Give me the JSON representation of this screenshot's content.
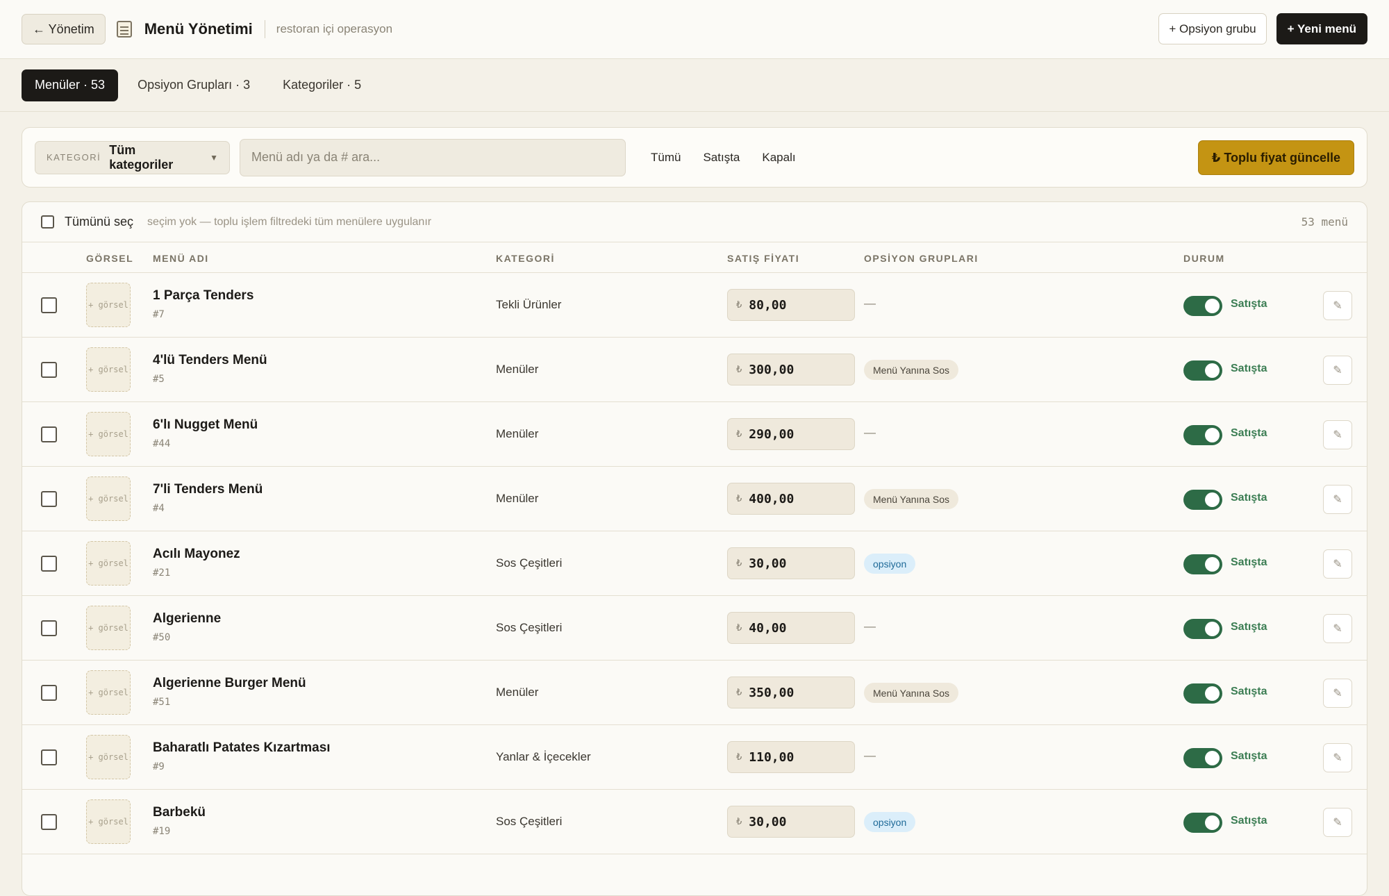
{
  "header": {
    "back_label": "← Yönetim",
    "title": "Menü Yönetimi",
    "subtitle": "restoran içi operasyon",
    "option_group_button": "+ Opsiyon grubu",
    "new_menu_button": "+ Yeni menü"
  },
  "tabs": [
    {
      "label": "Menüler · 53",
      "active": true
    },
    {
      "label": "Opsiyon Grupları · 3",
      "active": false
    },
    {
      "label": "Kategoriler · 5",
      "active": false
    }
  ],
  "filters": {
    "category_label": "KATEGORİ",
    "category_value": "Tüm kategoriler",
    "search_placeholder": "Menü adı ya da # ara...",
    "status_options": [
      "Tümü",
      "Satışta",
      "Kapalı"
    ],
    "bulk_price_button": "₺ Toplu fiyat güncelle"
  },
  "selection": {
    "select_all_label": "Tümünü seç",
    "hint": "seçim yok — toplu işlem filtredeki tüm menülere uygulanır",
    "count": "53 menü"
  },
  "columns": {
    "image": "GÖRSEL",
    "name": "MENÜ ADI",
    "category": "KATEGORİ",
    "price": "SATIŞ FİYATI",
    "option_groups": "OPSİYON GRUPLARI",
    "status": "DURUM"
  },
  "thumb_text": "+ görsel",
  "currency_symbol": "₺",
  "edit_icon": "pencil-icon",
  "rows": [
    {
      "name": "1 Parça Tenders",
      "id": "#7",
      "category": "Tekli Ürünler",
      "price": "80,00",
      "options": "—",
      "option_type": "none",
      "status": "Satışta"
    },
    {
      "name": "4'lü Tenders Menü",
      "id": "#5",
      "category": "Menüler",
      "price": "300,00",
      "options": "Menü Yanına Sos",
      "option_type": "sos",
      "status": "Satışta"
    },
    {
      "name": "6'lı Nugget Menü",
      "id": "#44",
      "category": "Menüler",
      "price": "290,00",
      "options": "—",
      "option_type": "none",
      "status": "Satışta"
    },
    {
      "name": "7'li Tenders Menü",
      "id": "#4",
      "category": "Menüler",
      "price": "400,00",
      "options": "Menü Yanına Sos",
      "option_type": "sos",
      "status": "Satışta"
    },
    {
      "name": "Acılı Mayonez",
      "id": "#21",
      "category": "Sos Çeşitleri",
      "price": "30,00",
      "options": "opsiyon",
      "option_type": "ops",
      "status": "Satışta"
    },
    {
      "name": "Algerienne",
      "id": "#50",
      "category": "Sos Çeşitleri",
      "price": "40,00",
      "options": "—",
      "option_type": "none",
      "status": "Satışta"
    },
    {
      "name": "Algerienne Burger Menü",
      "id": "#51",
      "category": "Menüler",
      "price": "350,00",
      "options": "Menü Yanına Sos",
      "option_type": "sos",
      "status": "Satışta"
    },
    {
      "name": "Baharatlı Patates Kızartması",
      "id": "#9",
      "category": "Yanlar & İçecekler",
      "price": "110,00",
      "options": "—",
      "option_type": "none",
      "status": "Satışta"
    },
    {
      "name": "Barbekü",
      "id": "#19",
      "category": "Sos Çeşitleri",
      "price": "30,00",
      "options": "opsiyon",
      "option_type": "ops",
      "status": "Satışta"
    }
  ]
}
